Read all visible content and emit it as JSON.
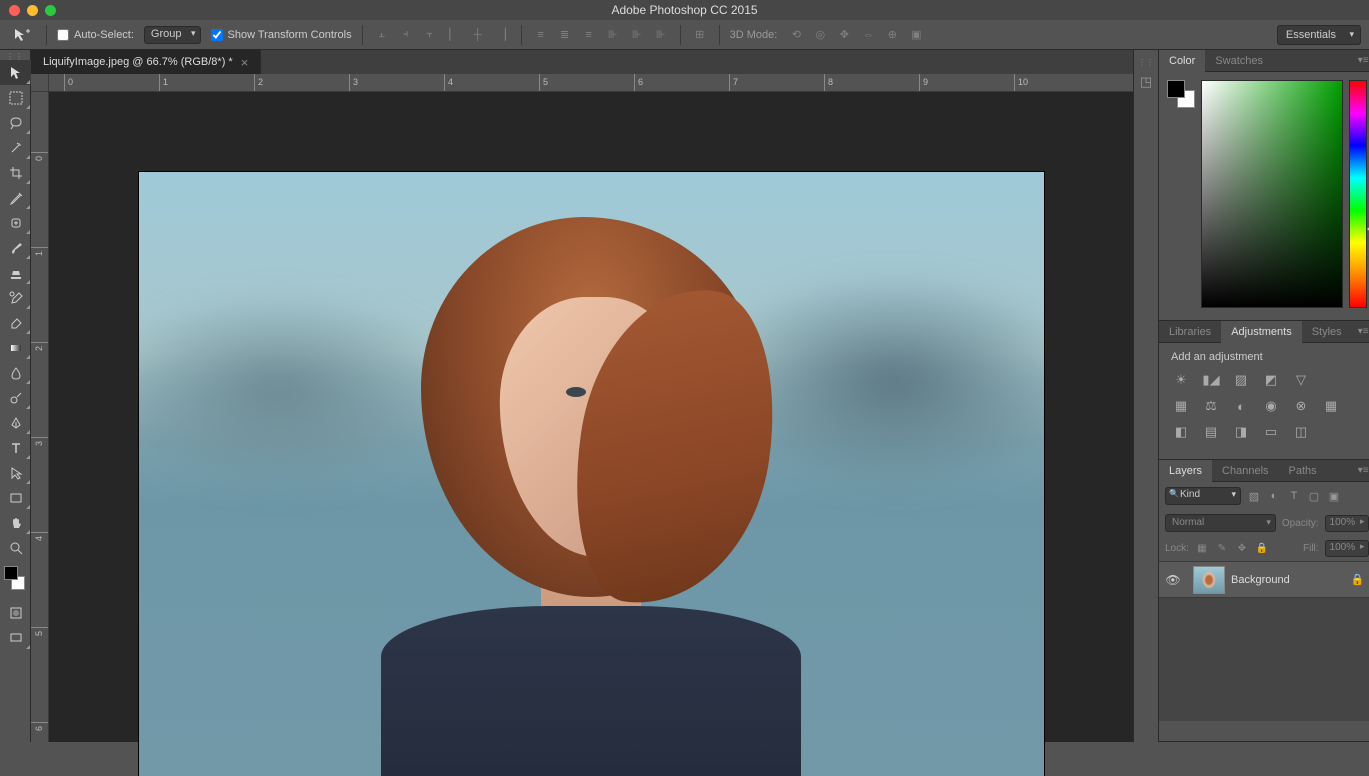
{
  "app": {
    "title": "Adobe Photoshop CC 2015"
  },
  "workspace": {
    "selected": "Essentials"
  },
  "options": {
    "auto_select_label": "Auto-Select:",
    "auto_select_checked": false,
    "auto_select_mode": "Group",
    "show_transform_label": "Show Transform Controls",
    "show_transform_checked": true,
    "mode_3d_label": "3D Mode:"
  },
  "document": {
    "tab_label": "LiquifyImage.jpeg @ 66.7% (RGB/8*) *"
  },
  "ruler": {
    "h_ticks": [
      "0",
      "1",
      "2",
      "3",
      "4",
      "5",
      "6",
      "7",
      "8",
      "9",
      "10"
    ],
    "v_ticks": [
      "0",
      "1",
      "2",
      "3",
      "4",
      "5",
      "6"
    ]
  },
  "tools": [
    "move",
    "marquee",
    "lasso",
    "magic-wand",
    "crop",
    "eyedropper",
    "spot-heal",
    "brush",
    "clone-stamp",
    "history-brush",
    "eraser",
    "gradient",
    "blur",
    "dodge",
    "pen",
    "type",
    "path-select",
    "rectangle",
    "hand",
    "zoom"
  ],
  "color_panel": {
    "tabs": [
      "Color",
      "Swatches"
    ],
    "active_tab": "Color",
    "foreground": "#000000",
    "background": "#ffffff",
    "hue_deg": 120
  },
  "adjustments_panel": {
    "tabs": [
      "Libraries",
      "Adjustments",
      "Styles"
    ],
    "active_tab": "Adjustments",
    "heading": "Add an adjustment",
    "row1": [
      "brightness",
      "levels",
      "curves",
      "exposure",
      "vibrance"
    ],
    "row2": [
      "hue-sat",
      "color-balance",
      "bw",
      "photo-filter",
      "channel-mixer",
      "color-lookup"
    ],
    "row3": [
      "invert",
      "posterize",
      "threshold",
      "gradient-map",
      "selective-color"
    ]
  },
  "layers_panel": {
    "tabs": [
      "Layers",
      "Channels",
      "Paths"
    ],
    "active_tab": "Layers",
    "filter_kind": "Kind",
    "blend_mode": "Normal",
    "opacity_label": "Opacity:",
    "opacity_value": "100%",
    "lock_label": "Lock:",
    "fill_label": "Fill:",
    "fill_value": "100%",
    "layers": [
      {
        "name": "Background",
        "visible": true,
        "locked": true
      }
    ]
  }
}
